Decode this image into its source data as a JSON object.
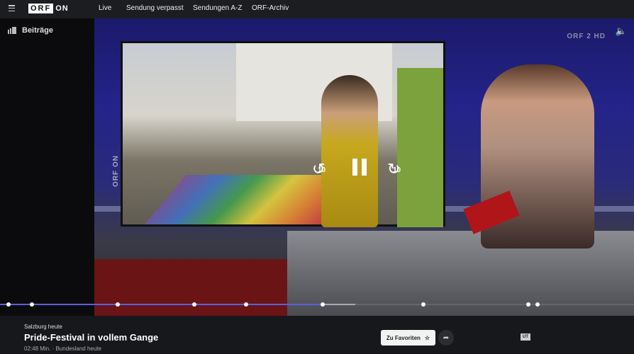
{
  "header": {
    "logo_orf": "ORF",
    "logo_on": "ON",
    "nav": [
      "Live",
      "Sendung verpasst",
      "Sendungen A-Z",
      "ORF-Archiv"
    ]
  },
  "sidebar": {
    "label": "Beiträge"
  },
  "player": {
    "channel_logo": "ORF 2 HD",
    "watermark": "ORF ON",
    "skip_back": "10",
    "skip_forward": "10",
    "state": "playing",
    "progress_percent": 51,
    "buffered_percent": 56,
    "chapter_markers_percent": [
      1.3,
      5,
      18.6,
      30.6,
      38.8,
      50.9,
      66.8,
      83.3,
      84.8
    ],
    "colors": {
      "played": "#5b5fe0",
      "buffered": "#aaaaaa"
    }
  },
  "info": {
    "show": "Salzburg heute",
    "title": "Pride-Festival in vollem Gange",
    "meta": "02:48 Min. · Bundesland heute",
    "favorite_label": "Zu Favoriten",
    "subtitles_badge": "UT"
  }
}
